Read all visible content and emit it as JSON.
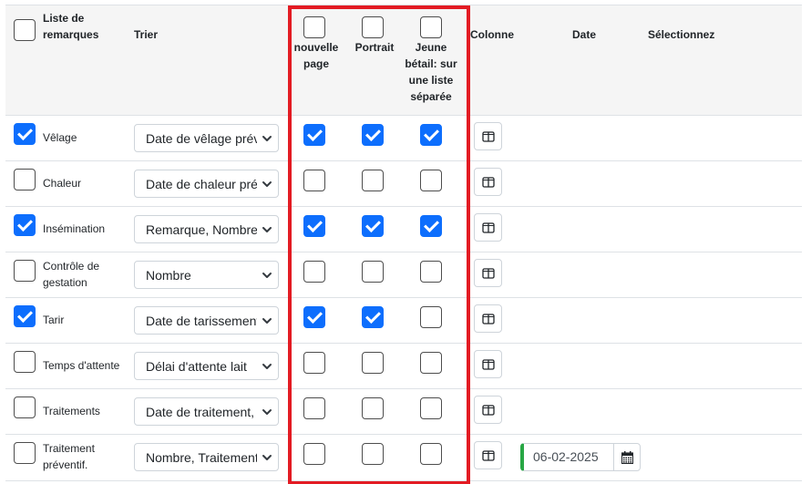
{
  "header": {
    "list_label": "Liste de remarques",
    "sort_label": "Trier",
    "new_page_label": "nouvelle page",
    "portrait_label": "Portrait",
    "young_label": "Jeune bétail: sur une liste séparée",
    "column_label": "Colonne",
    "date_label": "Date",
    "select_label": "Sélectionnez"
  },
  "rows": [
    {
      "label": "Vêlage",
      "sort": "Date de vêlage prévue",
      "checked": true,
      "new_page": true,
      "portrait": true,
      "young": true
    },
    {
      "label": "Chaleur",
      "sort": "Date de chaleur prévue",
      "checked": false,
      "new_page": false,
      "portrait": false,
      "young": false
    },
    {
      "label": "Insémination",
      "sort": "Remarque, Nombre",
      "checked": true,
      "new_page": true,
      "portrait": true,
      "young": true
    },
    {
      "label": "Contrôle de gestation",
      "sort": "Nombre",
      "checked": false,
      "new_page": false,
      "portrait": false,
      "young": false
    },
    {
      "label": "Tarir",
      "sort": "Date de tarissement",
      "checked": true,
      "new_page": true,
      "portrait": true,
      "young": false
    },
    {
      "label": "Temps d'attente",
      "sort": "Délai d'attente lait",
      "checked": false,
      "new_page": false,
      "portrait": false,
      "young": false
    },
    {
      "label": "Traitements",
      "sort": "Date de traitement, ",
      "checked": false,
      "new_page": false,
      "portrait": false,
      "young": false
    },
    {
      "label": "Traitement préventif.",
      "sort": "Nombre, Traitement",
      "checked": false,
      "new_page": false,
      "portrait": false,
      "young": false,
      "date": "06-02-2025"
    }
  ],
  "colors": {
    "accent": "#0d6efd",
    "highlight": "#e31b23",
    "date_border": "#28a745"
  },
  "icons": {
    "column": "column-layout-icon",
    "calendar": "calendar-icon",
    "chevron": "chevron-down-icon",
    "check": "checkmark-icon"
  }
}
